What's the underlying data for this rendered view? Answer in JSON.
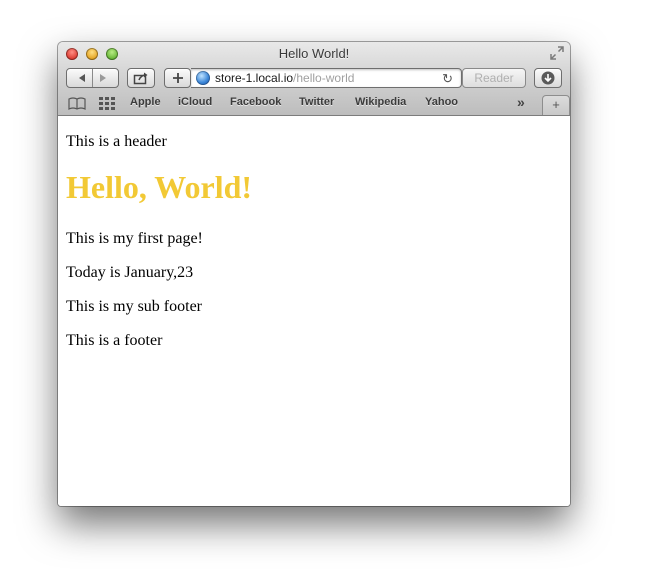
{
  "window": {
    "title": "Hello World!"
  },
  "toolbar": {
    "back_icon": "back-arrow-icon",
    "forward_icon": "forward-arrow-icon",
    "share_icon": "share-icon",
    "add_icon": "add-bookmark-icon",
    "address": {
      "host": "store-1.local.io",
      "path": "/hello-world"
    },
    "reader_label": "Reader",
    "download_icon": "download-icon"
  },
  "bookmarks": {
    "items": [
      "Apple",
      "iCloud",
      "Facebook",
      "Twitter",
      "Wikipedia",
      "Yahoo"
    ],
    "overflow_label": "»",
    "new_tab_label": "+"
  },
  "page": {
    "header_text": "This is a header",
    "heading": "Hello, World!",
    "paragraph": "This is my first page!",
    "date_text": "Today is January,23",
    "sub_footer_text": "This is my sub footer",
    "footer_text": "This is a footer"
  },
  "colors": {
    "heading": "#f2c935",
    "close": "#e0443a",
    "minimize": "#e7a92b",
    "zoom": "#6fbc3e"
  }
}
